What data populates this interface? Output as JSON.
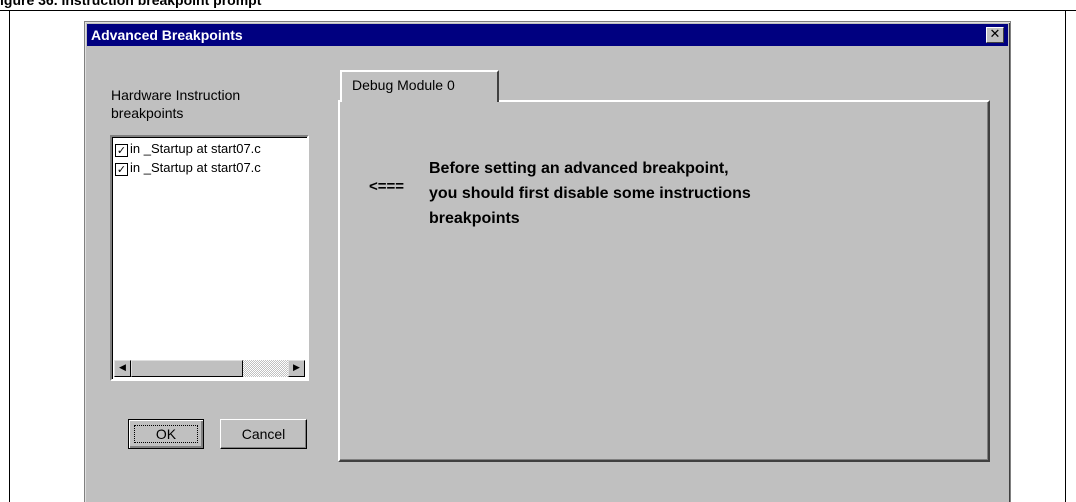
{
  "caption": "igure 36.     Instruction breakpoint prompt",
  "dialog": {
    "title": "Advanced Breakpoints",
    "close_glyph": "✕"
  },
  "hardware_list": {
    "label_line1": "Hardware Instruction",
    "label_line2": "breakpoints",
    "items": [
      {
        "checked": true,
        "text": "in _Startup at start07.c"
      },
      {
        "checked": true,
        "text": "in _Startup at start07.c"
      }
    ],
    "scroll_left_glyph": "◀",
    "scroll_right_glyph": "▶"
  },
  "buttons": {
    "ok_label": "OK",
    "cancel_label": "Cancel"
  },
  "tab": {
    "label": "Debug Module 0"
  },
  "panel": {
    "arrow": "<===",
    "message_lines": [
      "Before setting an advanced breakpoint,",
      "you should first disable some instructions",
      "breakpoints"
    ]
  },
  "colors": {
    "titlebar": "#000080",
    "dialog_face": "#c0c0c0"
  },
  "icons": {
    "check": "check-icon",
    "close": "close-icon"
  }
}
